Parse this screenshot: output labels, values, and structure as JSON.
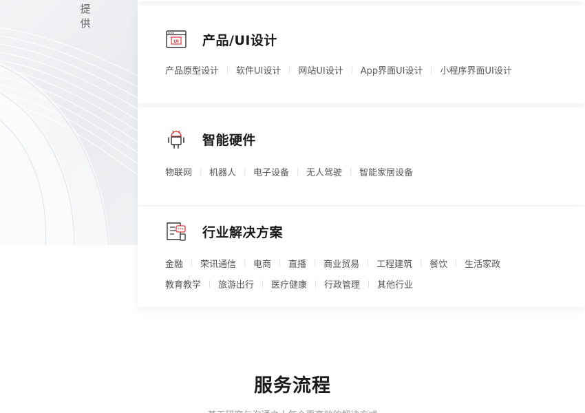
{
  "left_banner": {
    "vertical_text": "提供"
  },
  "cards": [
    {
      "icon": "ui-window-icon",
      "icon_text": "UI",
      "title": "产品/UI设计",
      "tags": [
        "产品原型设计",
        "软件UI设计",
        "网站UI设计",
        "App界面UI设计",
        "小程序界面UI设计"
      ]
    },
    {
      "icon": "android-robot-icon",
      "title": "智能硬件",
      "tags": [
        "物联网",
        "机器人",
        "电子设备",
        "无人驾驶",
        "智能家居设备"
      ]
    },
    {
      "icon": "solution-document-icon",
      "title": "行业解决方案",
      "tags_row1": [
        "金融",
        "荣讯通信",
        "电商",
        "直播",
        "商业贸易",
        "工程建筑",
        "餐饮",
        "生活家政"
      ],
      "tags_row2": [
        "教育教学",
        "旅游出行",
        "医疗健康",
        "行政管理",
        "其他行业"
      ]
    }
  ],
  "process": {
    "title": "服务流程",
    "subtitle": "基于研究与沟通之上每个更高效的解决方式"
  },
  "colors": {
    "accent": "#d9363e",
    "text_dark": "#1a1a1a",
    "text_tag": "#555555"
  }
}
